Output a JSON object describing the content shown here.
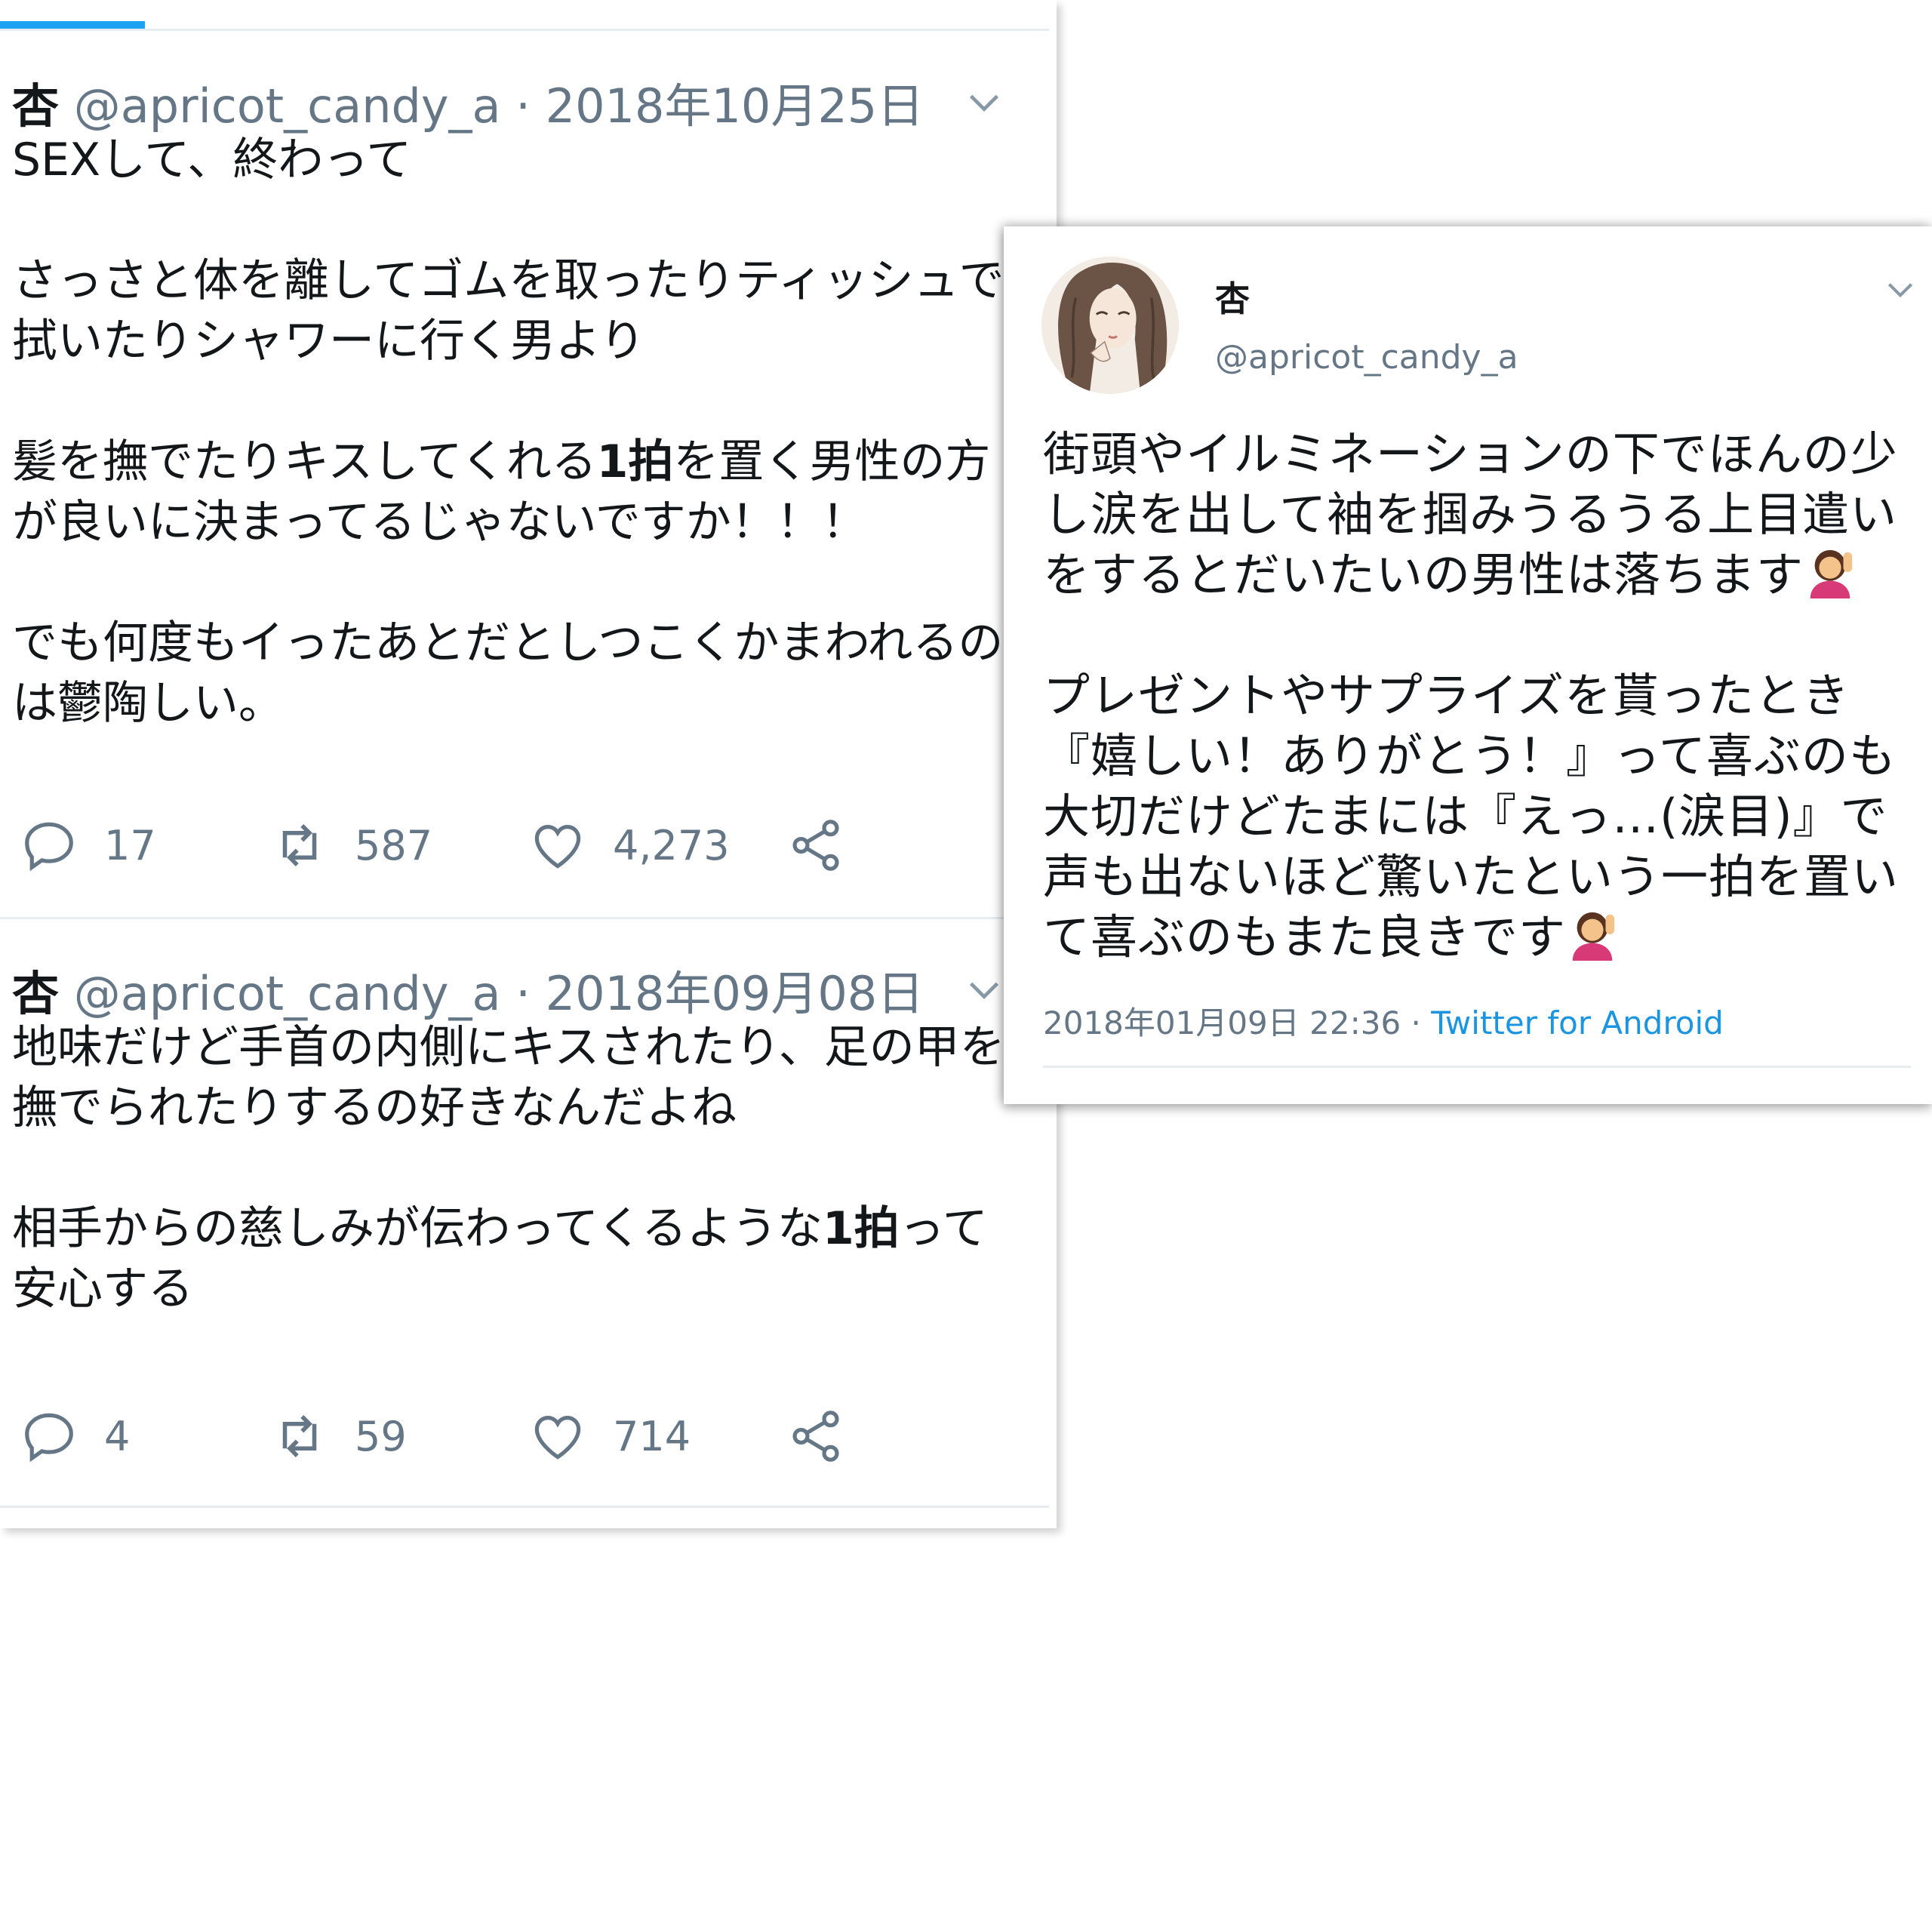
{
  "left_panel": {
    "tweets": [
      {
        "name": "杏",
        "meta": " @apricot_candy_a · 2018年10月25日",
        "body_1": "SEXして、終わって\n\nさっさと体を離してゴムを取ったりティッシュで拭いたりシャワーに行く男より\n\n髪を撫でたりキスしてくれる",
        "body_bold": "1拍",
        "body_2": "を置く男性の方が良いに決まってるじゃないですか！！！\n\nでも何度もイったあとだとしつこくかまわれるのは鬱陶しい。",
        "replies": "17",
        "retweets": "587",
        "likes": "4,273"
      },
      {
        "name": "杏",
        "meta": " @apricot_candy_a · 2018年09月08日",
        "body_1": "地味だけど手首の内側にキスされたり、足の甲を撫でられたりするの好きなんだよね\n\n相手からの慈しみが伝わってくるような",
        "body_bold": "1拍",
        "body_2": "って安心する",
        "replies": "4",
        "retweets": "59",
        "likes": "714"
      }
    ],
    "icons": [
      "reply-icon",
      "retweet-icon",
      "like-icon",
      "share-icon",
      "chevron-down-icon"
    ],
    "accent_color": "#1da1f2"
  },
  "right_panel": {
    "name": "杏",
    "handle": "@apricot_candy_a",
    "body_1": "街頭やイルミネーションの下でほんの少し涙を出して袖を掴みうるうる上目遣いをするとだいたいの男性は落ちます",
    "body_2": "\n\nプレゼントやサプライズを貰ったとき『嬉しい！ありがとう！』って喜ぶのも大切だけどたまには『えっ…(涙目)』で声も出ないほど驚いたという一拍を置いて喜ぶのもまた良きです",
    "timestamp": "2018年01月09日 22:36 · ",
    "client": "Twitter for Android",
    "link_color": "#1b95e0"
  }
}
